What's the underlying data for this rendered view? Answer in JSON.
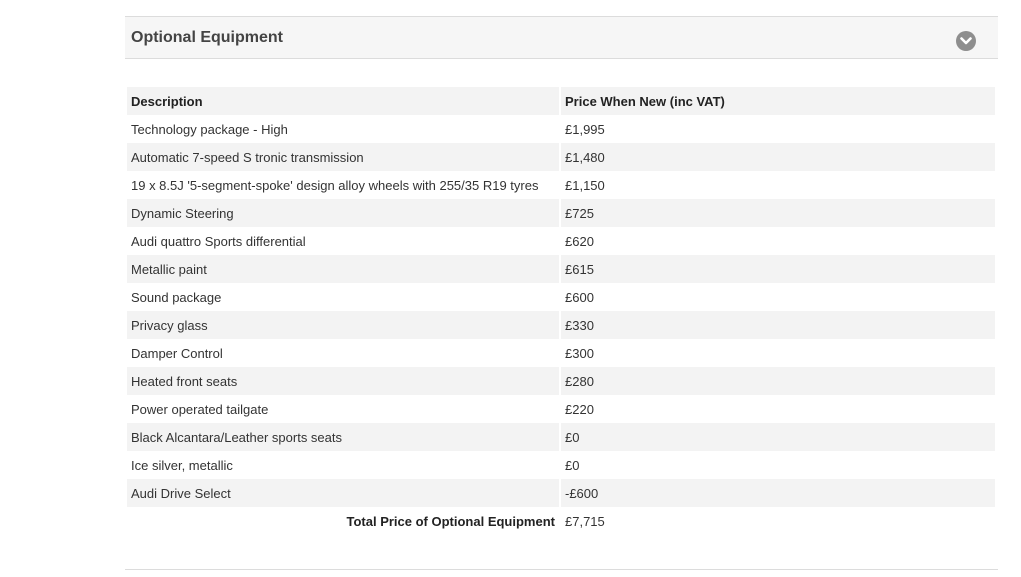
{
  "panel": {
    "title": "Optional Equipment",
    "toggle_icon": "chevron-down-icon"
  },
  "table": {
    "headers": {
      "description": "Description",
      "price": "Price When New (inc VAT)"
    },
    "rows": [
      {
        "description": "Technology package - High",
        "price": "£1,995"
      },
      {
        "description": "Automatic 7-speed S tronic transmission",
        "price": "£1,480"
      },
      {
        "description": "19 x 8.5J '5-segment-spoke' design alloy wheels with 255/35 R19 tyres",
        "price": "£1,150"
      },
      {
        "description": "Dynamic Steering",
        "price": "£725"
      },
      {
        "description": "Audi quattro Sports differential",
        "price": "£620"
      },
      {
        "description": "Metallic paint",
        "price": "£615"
      },
      {
        "description": "Sound package",
        "price": "£600"
      },
      {
        "description": "Privacy glass",
        "price": "£330"
      },
      {
        "description": "Damper Control",
        "price": "£300"
      },
      {
        "description": "Heated front seats",
        "price": "£280"
      },
      {
        "description": "Power operated tailgate",
        "price": "£220"
      },
      {
        "description": "Black Alcantara/Leather sports seats",
        "price": "£0"
      },
      {
        "description": "Ice silver, metallic",
        "price": "£0"
      },
      {
        "description": "Audi Drive Select",
        "price": "-£600"
      }
    ],
    "total": {
      "label": "Total Price of Optional Equipment",
      "value": "£7,715"
    }
  },
  "colors": {
    "header_bg": "#f6f6f6",
    "row_shade": "#f3f3f3",
    "toggle_bg": "#8e8e8e"
  }
}
